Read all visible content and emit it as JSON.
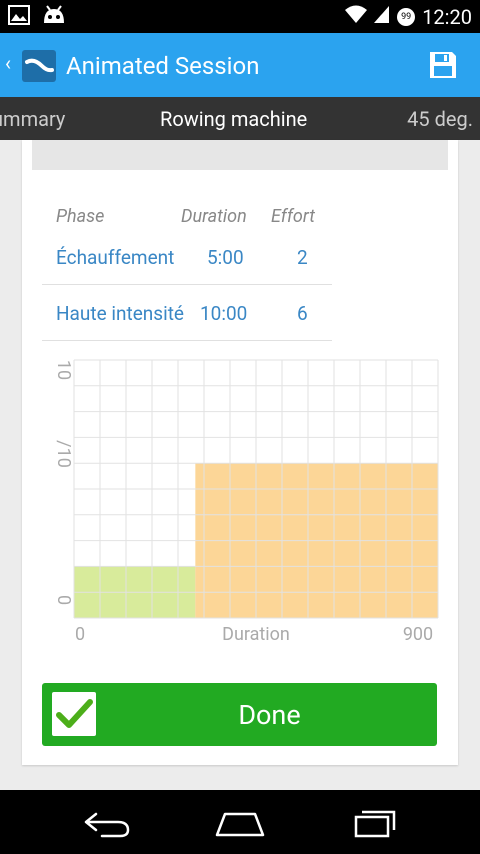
{
  "status_bar": {
    "time": "12:20",
    "notification_count": "99"
  },
  "action_bar": {
    "title": "Animated Session"
  },
  "tabs": {
    "left": "ummary",
    "active": "Rowing machine",
    "right": "45 deg."
  },
  "table": {
    "headers": [
      "Phase",
      "Duration",
      "Effort"
    ],
    "rows": [
      {
        "phase": "Échauffement",
        "duration": "5:00",
        "effort": "2"
      },
      {
        "phase": "Haute intensité",
        "duration": "10:00",
        "effort": "6"
      }
    ]
  },
  "chart_data": {
    "type": "area",
    "xlabel": "Duration",
    "ylabel": "/10",
    "x_tick_labels": [
      "0",
      "900"
    ],
    "y_tick_labels": [
      "0",
      "10"
    ],
    "xlim": [
      0,
      900
    ],
    "ylim": [
      0,
      10
    ],
    "grid": true,
    "series": [
      {
        "x_start": 0,
        "x_end": 300,
        "value": 2,
        "color": "#d8eb9b"
      },
      {
        "x_start": 300,
        "x_end": 900,
        "value": 6,
        "color": "#fcd697"
      }
    ]
  },
  "done_button": {
    "label": "Done"
  },
  "colors": {
    "accent": "#2ba3ef",
    "done": "#22aa22",
    "link": "#3a87c5"
  }
}
